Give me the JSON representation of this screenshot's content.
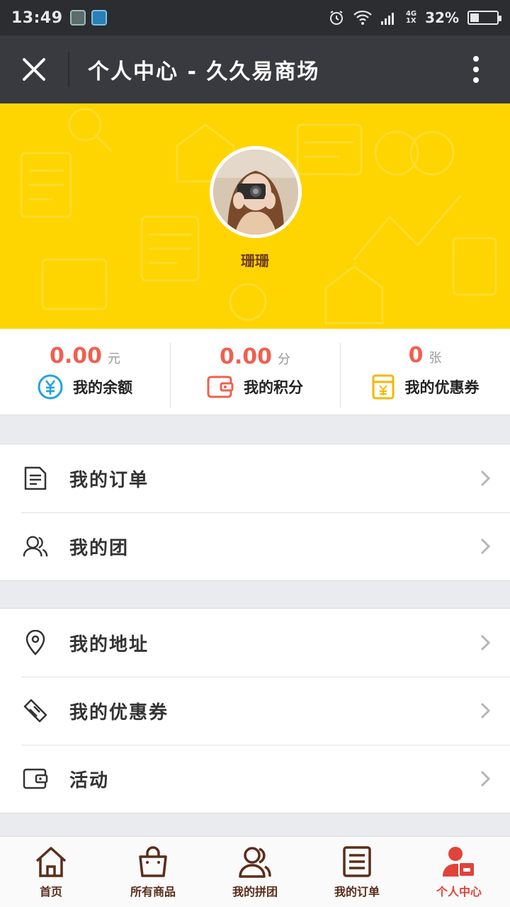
{
  "status_bar": {
    "time": "13:49",
    "network_top": "4G",
    "network_bottom": "1X",
    "battery_text": "32%",
    "battery_level": 0.32
  },
  "title_bar": {
    "title": "个人中心 - 久久易商场"
  },
  "profile": {
    "username": "珊珊"
  },
  "stats": [
    {
      "value": "0.00",
      "unit": "元",
      "label": "我的余额",
      "icon": "yen-circle-icon",
      "color": "#1fa3e0"
    },
    {
      "value": "0.00",
      "unit": "分",
      "label": "我的积分",
      "icon": "wallet-icon",
      "color": "#f0604f"
    },
    {
      "value": "0",
      "unit": "张",
      "label": "我的优惠券",
      "icon": "coupon-icon",
      "color": "#f5b800"
    }
  ],
  "menu_group_1": [
    {
      "label": "我的订单",
      "icon": "document-icon"
    },
    {
      "label": "我的团",
      "icon": "users-icon"
    }
  ],
  "menu_group_2": [
    {
      "label": "我的地址",
      "icon": "location-pin-icon"
    },
    {
      "label": "我的优惠券",
      "icon": "ticket-icon"
    },
    {
      "label": "活动",
      "icon": "wallet-icon"
    }
  ],
  "bottom_nav": [
    {
      "label": "首页",
      "icon": "home-icon"
    },
    {
      "label": "所有商品",
      "icon": "shopping-bag-icon"
    },
    {
      "label": "我的拼团",
      "icon": "group-icon"
    },
    {
      "label": "我的订单",
      "icon": "list-icon"
    },
    {
      "label": "个人中心",
      "icon": "user-card-icon",
      "active": true
    }
  ],
  "colors": {
    "banner": "#fed500",
    "title_bar": "#393a3f",
    "accent_red": "#f0604f",
    "nav_brown": "#5a2d1a",
    "nav_active": "#e0433a"
  }
}
